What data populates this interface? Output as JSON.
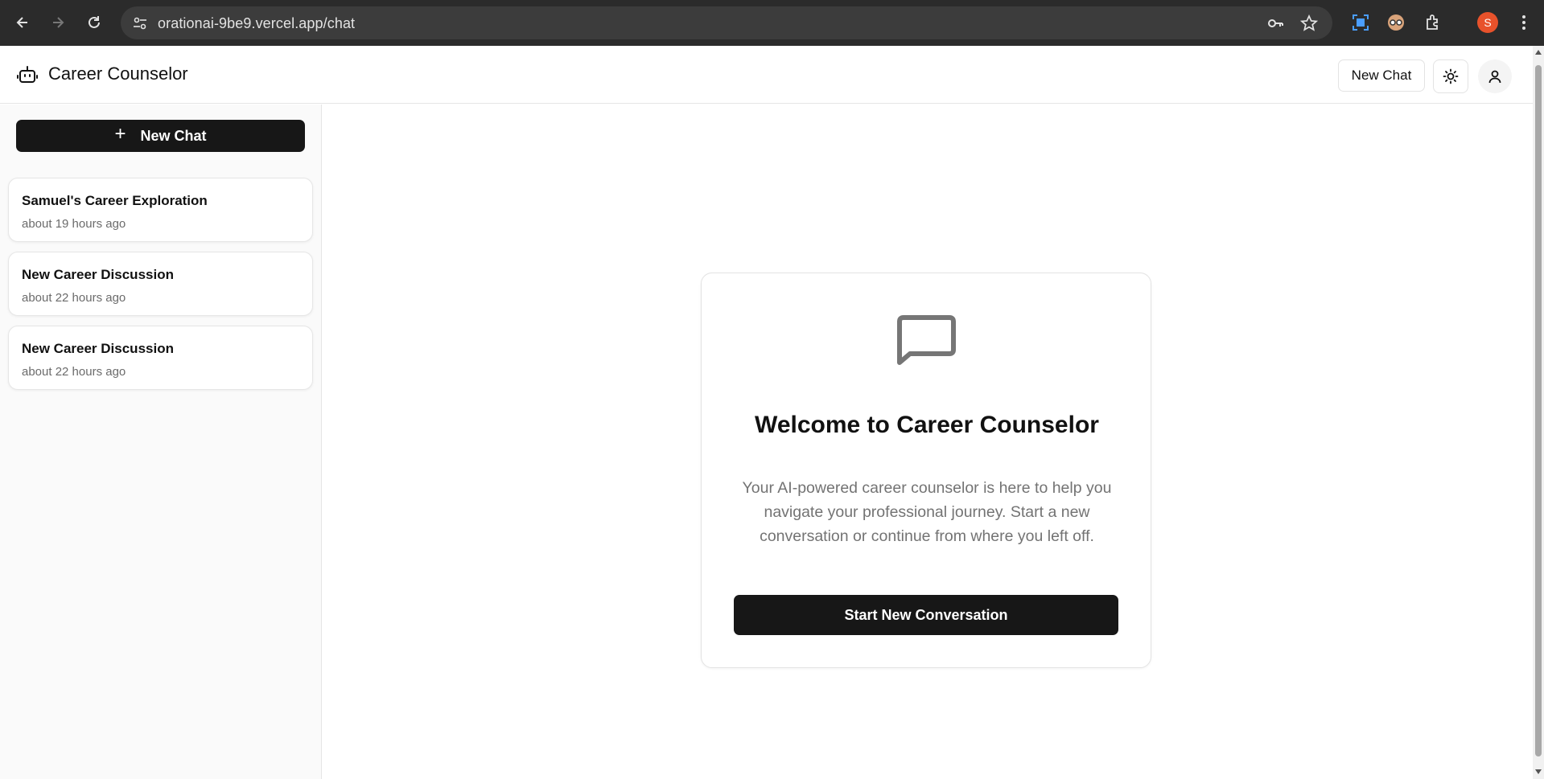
{
  "browser": {
    "url": "orationai-9be9.vercel.app/chat",
    "profile_initial": "S",
    "profile_color": "#e8522b"
  },
  "header": {
    "title": "Career Counselor",
    "new_chat_label": "New Chat"
  },
  "sidebar": {
    "new_chat_label": "New Chat",
    "chats": [
      {
        "title": "Samuel's Career Exploration",
        "time": "about 19 hours ago"
      },
      {
        "title": "New Career Discussion",
        "time": "about 22 hours ago"
      },
      {
        "title": "New Career Discussion",
        "time": "about 22 hours ago"
      }
    ]
  },
  "welcome": {
    "title": "Welcome to Career Counselor",
    "description": "Your AI-powered career counselor is here to help you navigate your professional journey. Start a new conversation or continue from where you left off.",
    "button_label": "Start New Conversation"
  },
  "colors": {
    "primary_button": "#171717",
    "chrome_bg": "#2b2b2b",
    "muted_text": "#737373"
  }
}
